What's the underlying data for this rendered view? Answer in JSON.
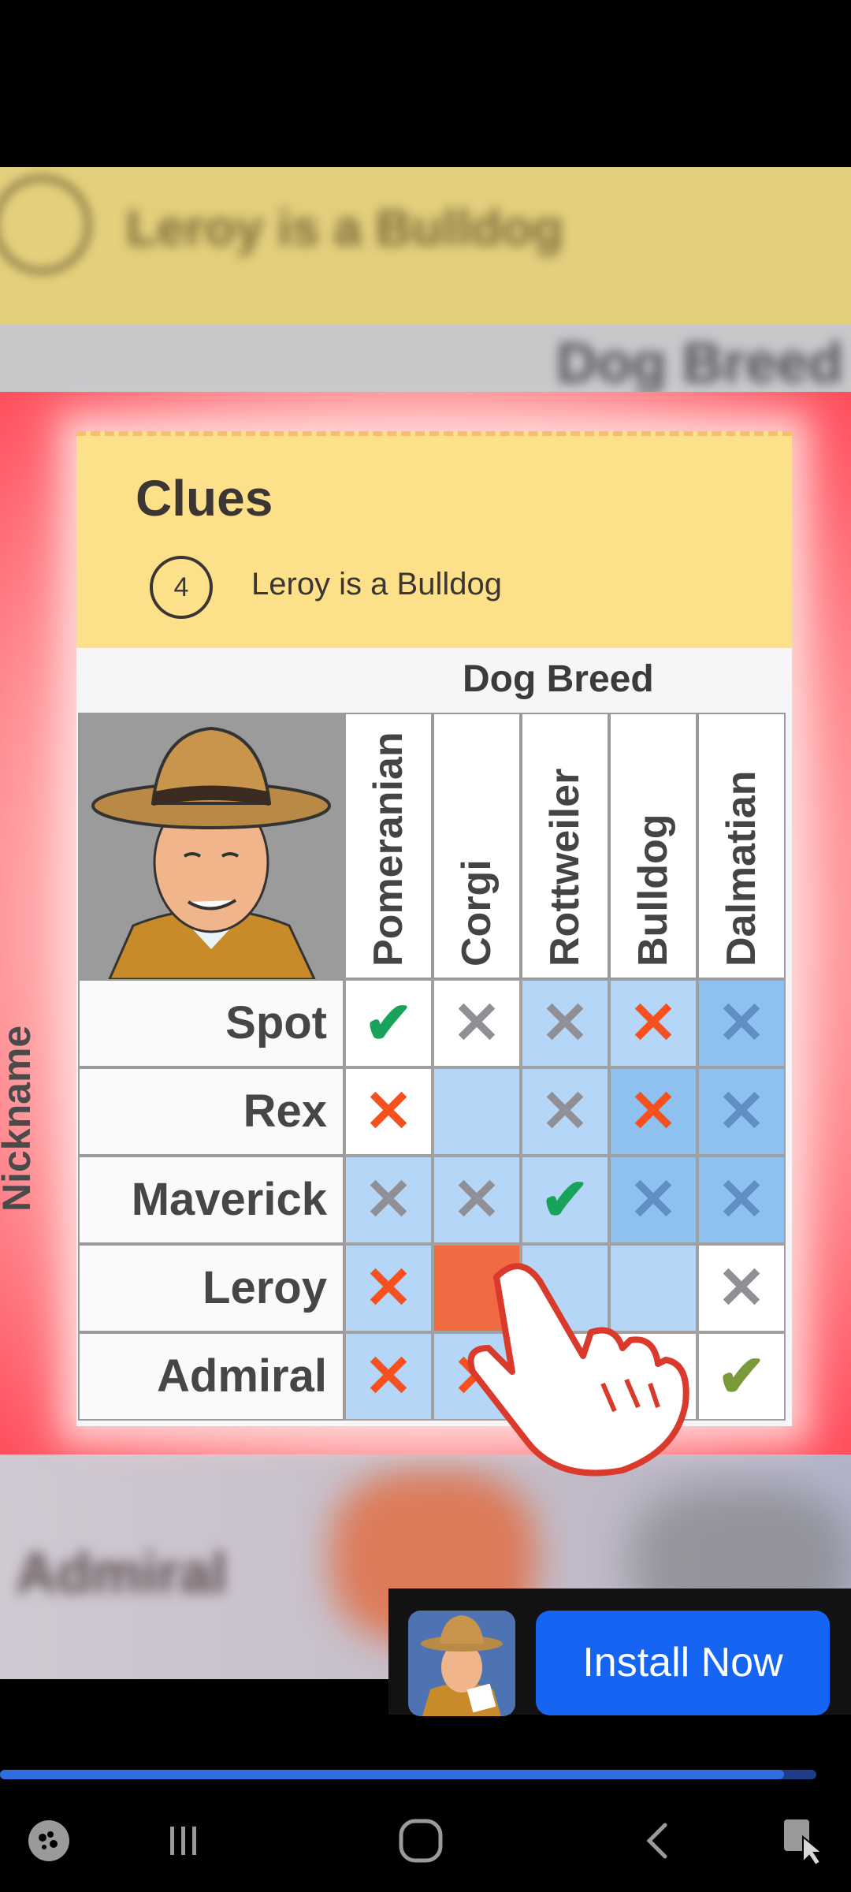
{
  "background": {
    "top_blur_text": "Leroy is a Bulldog",
    "strip_blur_text": "Dog Breed",
    "bottom_blur_text": "Admiral"
  },
  "clues": {
    "title": "Clues",
    "number": "4",
    "text": "Leroy is a Bulldog"
  },
  "grid": {
    "column_group_label": "Dog Breed",
    "row_group_label": "Nickname",
    "columns": [
      "Pomeranian",
      "Corgi",
      "Rottweiler",
      "Bulldog",
      "Dalmatian"
    ],
    "rows": [
      {
        "label": "Spot",
        "cells": [
          "check",
          "x-gray",
          "x-gray",
          "x-red",
          "x-blue"
        ]
      },
      {
        "label": "Rex",
        "cells": [
          "x-red",
          "",
          "x-gray",
          "x-red",
          "x-blue"
        ]
      },
      {
        "label": "Maverick",
        "cells": [
          "x-gray",
          "x-gray",
          "check",
          "x-blue",
          "x-blue"
        ]
      },
      {
        "label": "Leroy",
        "cells": [
          "x-red",
          "filled",
          "",
          "",
          "x-gray"
        ]
      },
      {
        "label": "Admiral",
        "cells": [
          "x-red",
          "x-red",
          "",
          "x-red",
          "check-olive"
        ]
      }
    ]
  },
  "ad": {
    "install_label": "Install Now",
    "progress_fraction": 0.96
  },
  "navbar": {
    "items": [
      "game-launcher-icon",
      "recent-apps-icon",
      "home-icon",
      "back-icon",
      "accessibility-icon"
    ]
  },
  "colors": {
    "frame_red": "#ff4d5b",
    "clues_yellow": "#fce08a",
    "install_blue": "#1565f2",
    "check_green": "#17a45a",
    "x_red": "#f4511e",
    "x_gray": "#8f8f95",
    "cell_blue": "#b5d6f6"
  }
}
